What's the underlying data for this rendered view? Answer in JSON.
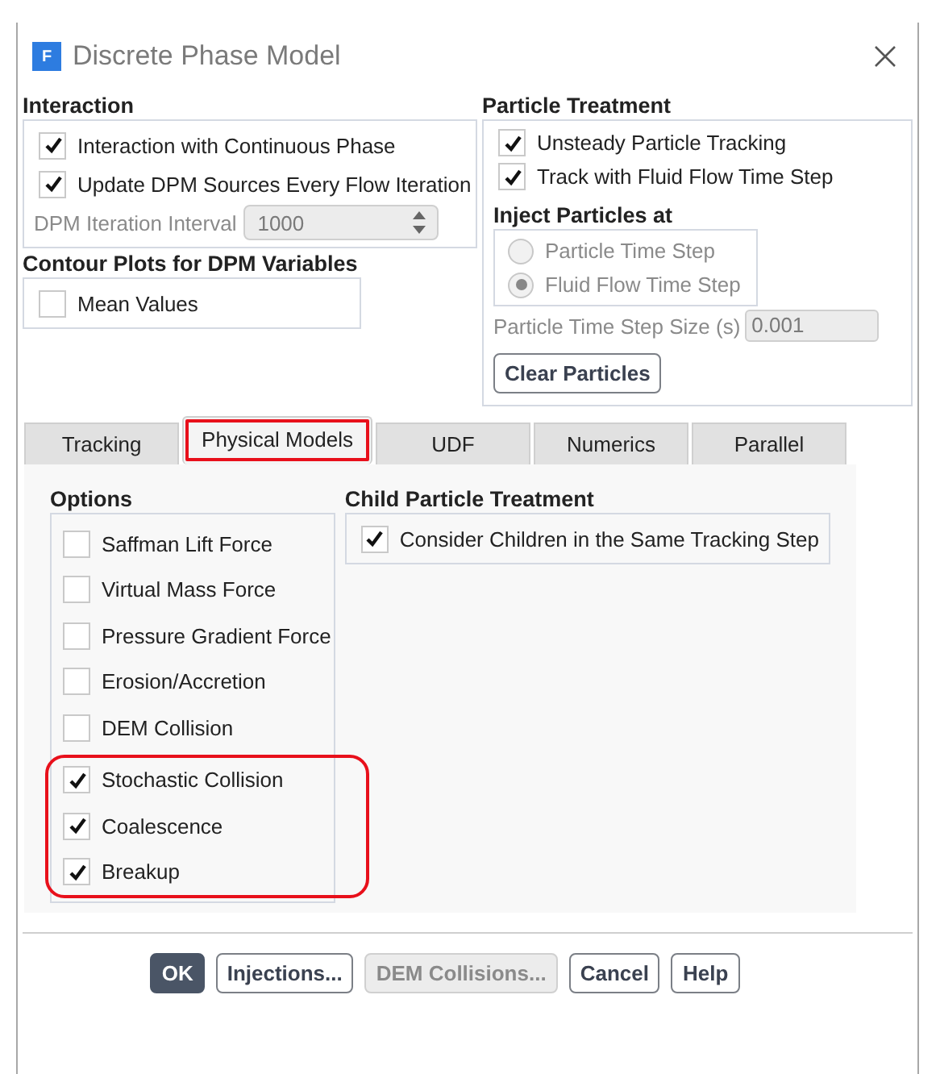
{
  "window": {
    "icon_letter": "F",
    "title": "Discrete Phase Model"
  },
  "interaction": {
    "title": "Interaction",
    "options": [
      {
        "label": "Interaction with Continuous Phase",
        "checked": true
      },
      {
        "label": "Update DPM Sources Every Flow Iteration",
        "checked": true
      }
    ],
    "iteration_interval": {
      "label": "DPM Iteration Interval",
      "value": "1000",
      "disabled": true
    }
  },
  "contour_plots": {
    "title": "Contour Plots for DPM Variables",
    "options": [
      {
        "label": "Mean Values",
        "checked": false
      }
    ]
  },
  "particle_treatment": {
    "title": "Particle Treatment",
    "options": [
      {
        "label": "Unsteady Particle Tracking",
        "checked": true
      },
      {
        "label": "Track with Fluid Flow Time Step",
        "checked": true
      }
    ],
    "inject": {
      "title": "Inject Particles at",
      "disabled": true,
      "options": [
        {
          "label": "Particle Time Step",
          "selected": false
        },
        {
          "label": "Fluid Flow Time Step",
          "selected": true
        }
      ]
    },
    "time_step_size": {
      "label": "Particle Time Step Size (s)",
      "value": "0.001",
      "disabled": true
    },
    "clear_button": "Clear Particles"
  },
  "tabs": [
    {
      "label": "Tracking",
      "selected": false,
      "highlighted": false
    },
    {
      "label": "Physical Models",
      "selected": true,
      "highlighted": true
    },
    {
      "label": "UDF",
      "selected": false,
      "highlighted": false
    },
    {
      "label": "Numerics",
      "selected": false,
      "highlighted": false
    },
    {
      "label": "Parallel",
      "selected": false,
      "highlighted": false
    }
  ],
  "options": {
    "title": "Options",
    "groups": [
      {
        "highlighted": false,
        "items": [
          {
            "label": "Saffman Lift Force",
            "checked": false
          },
          {
            "label": "Virtual Mass Force",
            "checked": false
          },
          {
            "label": "Pressure Gradient Force",
            "checked": false
          },
          {
            "label": "Erosion/Accretion",
            "checked": false
          },
          {
            "label": "DEM Collision",
            "checked": false
          }
        ]
      },
      {
        "highlighted": true,
        "items": [
          {
            "label": "Stochastic Collision",
            "checked": true
          },
          {
            "label": "Coalescence",
            "checked": true
          },
          {
            "label": "Breakup",
            "checked": true
          }
        ]
      }
    ]
  },
  "child_treatment": {
    "title": "Child Particle Treatment",
    "options": [
      {
        "label": "Consider Children in the Same Tracking Step",
        "checked": true
      }
    ]
  },
  "buttons": [
    {
      "label": "OK",
      "default": true,
      "disabled": false
    },
    {
      "label": "Injections...",
      "default": false,
      "disabled": false
    },
    {
      "label": "DEM Collisions...",
      "default": false,
      "disabled": true
    },
    {
      "label": "Cancel",
      "default": false,
      "disabled": false
    },
    {
      "label": "Help",
      "default": false,
      "disabled": false
    }
  ]
}
